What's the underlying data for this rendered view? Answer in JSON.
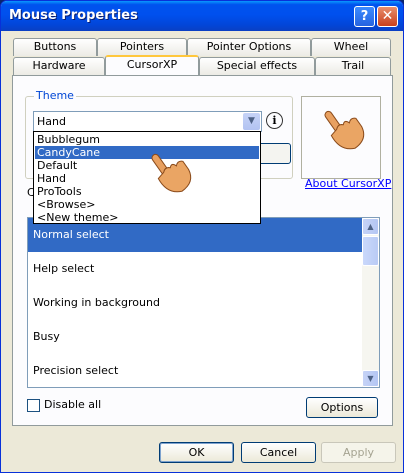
{
  "window": {
    "title": "Mouse Properties",
    "help_glyph": "?",
    "close_glyph": "✕"
  },
  "tabs": {
    "row1": [
      "Buttons",
      "Pointers",
      "Pointer Options",
      "Wheel"
    ],
    "row2": [
      "Hardware",
      "CursorXP",
      "Special effects",
      "Trail"
    ],
    "active": "CursorXP"
  },
  "theme": {
    "group_label": "Theme",
    "selected": "Hand",
    "info_glyph": "i",
    "options": [
      "Bubblegum",
      "CandyCane",
      "Default",
      "Hand",
      "ProTools",
      "<Browse>",
      "<New theme>"
    ],
    "highlighted": "CandyCane"
  },
  "about_link": "About CursorXP",
  "cursor_list_label": "C",
  "cursor_list": [
    "Normal select",
    "Help select",
    "Working in background",
    "Busy",
    "Precision select"
  ],
  "cursor_list_selected": "Normal select",
  "disable_all": {
    "label": "Disable all",
    "checked": false
  },
  "buttons": {
    "options": "Options",
    "ok": "OK",
    "cancel": "Cancel",
    "apply": "Apply"
  },
  "colors": {
    "accent": "#316ac5",
    "titlebar": "#0053ee",
    "link": "#0000ff"
  },
  "icons": {
    "preview": "hand-pointer-icon",
    "dropdown_cursor": "hand-pointer-icon"
  }
}
